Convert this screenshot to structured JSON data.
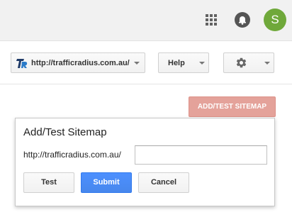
{
  "header": {
    "avatar_initial": "S",
    "avatar_color": "#6fa83a"
  },
  "toolbar": {
    "site_select": {
      "label": "http://trafficradius.com.au/"
    },
    "help_label": "Help"
  },
  "page": {
    "add_test_button_label": "ADD/TEST SITEMAP",
    "add_test_button_color": "#e4a29a"
  },
  "dialog": {
    "title": "Add/Test Sitemap",
    "url_prefix": "http://trafficradius.com.au/",
    "path_input": {
      "value": "",
      "placeholder": ""
    },
    "buttons": {
      "test_label": "Test",
      "submit_label": "Submit",
      "cancel_label": "Cancel"
    },
    "submit_color": "#4d90fe"
  }
}
